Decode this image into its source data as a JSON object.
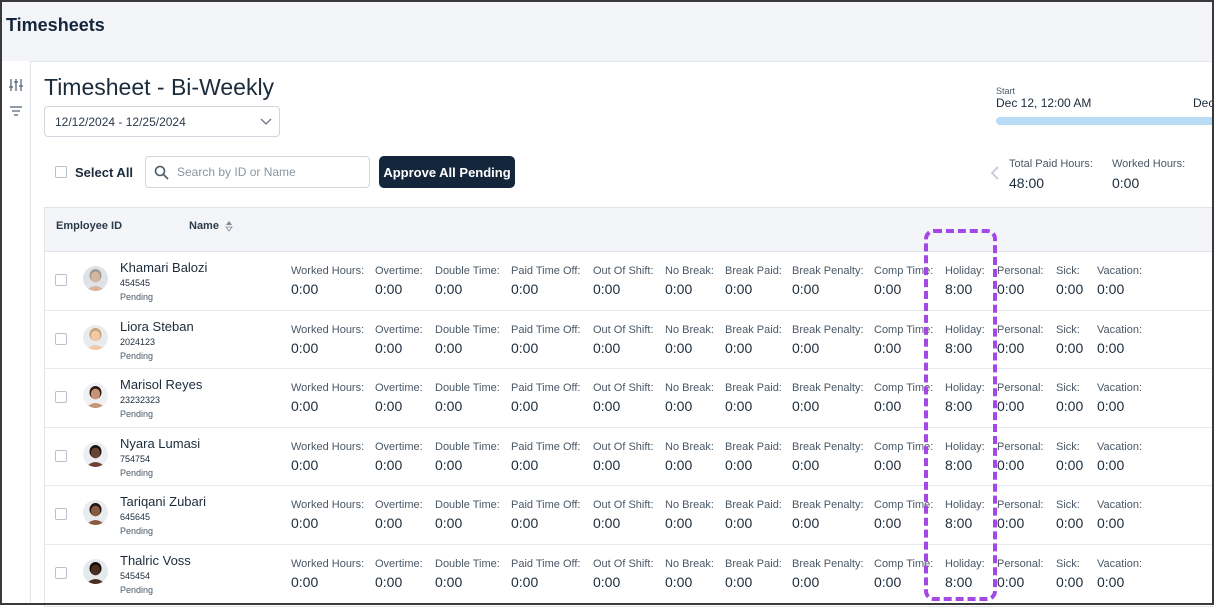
{
  "app": {
    "title": "Timesheets"
  },
  "page": {
    "title": "Timesheet - Bi-Weekly",
    "date_range": "12/12/2024 - 12/25/2024"
  },
  "toolbar": {
    "select_all_label": "Select All",
    "search_placeholder": "Search by ID or Name",
    "search_value": "",
    "approve_label": "Approve All Pending"
  },
  "period": {
    "start_label": "Start",
    "start_value": "Dec 12, 12:00 AM",
    "end_value_partial": "Dec"
  },
  "summary": {
    "total_paid_label": "Total Paid Hours:",
    "total_paid_value": "48:00",
    "worked_label": "Worked Hours:",
    "worked_value": "0:00"
  },
  "table": {
    "headers": {
      "employee_id": "Employee ID",
      "name": "Name"
    },
    "metric_labels": [
      "Worked Hours:",
      "Overtime:",
      "Double Time:",
      "Paid Time Off:",
      "Out Of Shift:",
      "No Break:",
      "Break Paid:",
      "Break Penalty:",
      "Comp Time:",
      "Holiday:",
      "Personal:",
      "Sick:",
      "Vacation:"
    ],
    "rows": [
      {
        "name": "Khamari Balozi",
        "id": "454545",
        "status": "Pending",
        "avatar": {
          "skin": "#d8b49a",
          "hair": "#9a9a9a",
          "bg": "#dfe3e8"
        },
        "values": [
          "0:00",
          "0:00",
          "0:00",
          "0:00",
          "0:00",
          "0:00",
          "0:00",
          "0:00",
          "0:00",
          "8:00",
          "0:00",
          "0:00",
          "0:00"
        ]
      },
      {
        "name": "Liora Steban",
        "id": "2024123",
        "status": "Pending",
        "avatar": {
          "skin": "#f0c9a8",
          "hair": "#c9a274",
          "bg": "#e9ecef"
        },
        "values": [
          "0:00",
          "0:00",
          "0:00",
          "0:00",
          "0:00",
          "0:00",
          "0:00",
          "0:00",
          "0:00",
          "8:00",
          "0:00",
          "0:00",
          "0:00"
        ]
      },
      {
        "name": "Marisol Reyes",
        "id": "23232323",
        "status": "Pending",
        "avatar": {
          "skin": "#c89476",
          "hair": "#2a1a14",
          "bg": "#eef0f2"
        },
        "values": [
          "0:00",
          "0:00",
          "0:00",
          "0:00",
          "0:00",
          "0:00",
          "0:00",
          "0:00",
          "0:00",
          "8:00",
          "0:00",
          "0:00",
          "0:00"
        ]
      },
      {
        "name": "Nyara Lumasi",
        "id": "754754",
        "status": "Pending",
        "avatar": {
          "skin": "#6b4330",
          "hair": "#1a120e",
          "bg": "#eceff2"
        },
        "values": [
          "0:00",
          "0:00",
          "0:00",
          "0:00",
          "0:00",
          "0:00",
          "0:00",
          "0:00",
          "0:00",
          "8:00",
          "0:00",
          "0:00",
          "0:00"
        ]
      },
      {
        "name": "Tariqani Zubari",
        "id": "645645",
        "status": "Pending",
        "avatar": {
          "skin": "#8a5a40",
          "hair": "#1e1612",
          "bg": "#e9ecef"
        },
        "values": [
          "0:00",
          "0:00",
          "0:00",
          "0:00",
          "0:00",
          "0:00",
          "0:00",
          "0:00",
          "0:00",
          "8:00",
          "0:00",
          "0:00",
          "0:00"
        ]
      },
      {
        "name": "Thalric Voss",
        "id": "545454",
        "status": "Pending",
        "avatar": {
          "skin": "#4a2e22",
          "hair": "#120c0a",
          "bg": "#e6e9ec"
        },
        "values": [
          "0:00",
          "0:00",
          "0:00",
          "0:00",
          "0:00",
          "0:00",
          "0:00",
          "0:00",
          "0:00",
          "8:00",
          "0:00",
          "0:00",
          "0:00"
        ]
      }
    ]
  },
  "icons": {
    "rail": [
      "sliders-icon",
      "filter-icon"
    ],
    "search": "search-icon",
    "select": "chevron-down-icon",
    "sort": "sort-icon",
    "prev": "chevron-left-icon"
  },
  "colors": {
    "primary": "#13263b",
    "progress": "#b9dcf6",
    "highlight": "#a347e6",
    "header_bg": "#f3f5f8"
  }
}
